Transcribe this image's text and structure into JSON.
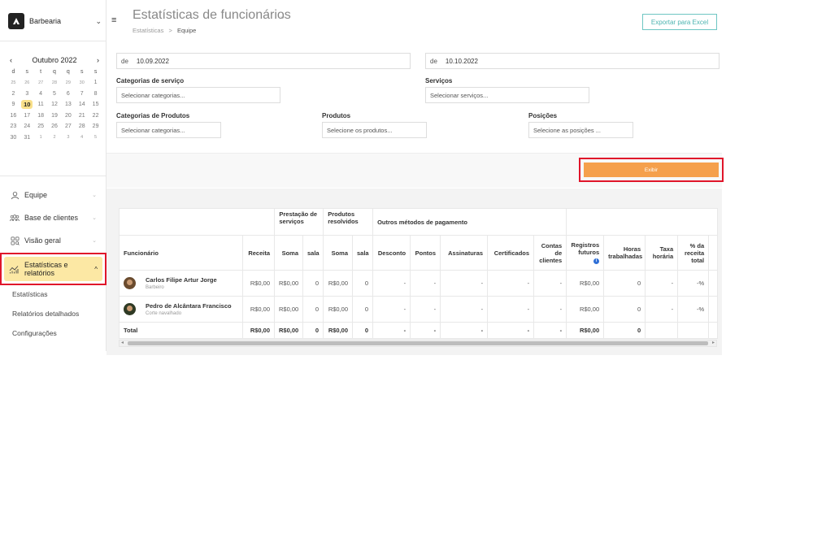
{
  "brand": {
    "name": "Barbearia"
  },
  "calendar": {
    "month_label": "Outubro 2022",
    "weekdays": [
      "d",
      "s",
      "t",
      "q",
      "q",
      "s",
      "s"
    ],
    "weeks": [
      [
        {
          "d": "25",
          "o": true
        },
        {
          "d": "26",
          "o": true
        },
        {
          "d": "27",
          "o": true
        },
        {
          "d": "28",
          "o": true
        },
        {
          "d": "29",
          "o": true
        },
        {
          "d": "30",
          "o": true
        },
        {
          "d": "1",
          "o": false
        }
      ],
      [
        {
          "d": "2",
          "o": false
        },
        {
          "d": "3",
          "o": false
        },
        {
          "d": "4",
          "o": false
        },
        {
          "d": "5",
          "o": false
        },
        {
          "d": "6",
          "o": false
        },
        {
          "d": "7",
          "o": false
        },
        {
          "d": "8",
          "o": false
        }
      ],
      [
        {
          "d": "9",
          "o": false
        },
        {
          "d": "10",
          "o": false,
          "t": true
        },
        {
          "d": "11",
          "o": false
        },
        {
          "d": "12",
          "o": false
        },
        {
          "d": "13",
          "o": false
        },
        {
          "d": "14",
          "o": false
        },
        {
          "d": "15",
          "o": false
        }
      ],
      [
        {
          "d": "16",
          "o": false
        },
        {
          "d": "17",
          "o": false
        },
        {
          "d": "18",
          "o": false
        },
        {
          "d": "19",
          "o": false
        },
        {
          "d": "20",
          "o": false
        },
        {
          "d": "21",
          "o": false
        },
        {
          "d": "22",
          "o": false
        }
      ],
      [
        {
          "d": "23",
          "o": false
        },
        {
          "d": "24",
          "o": false
        },
        {
          "d": "25",
          "o": false
        },
        {
          "d": "26",
          "o": false
        },
        {
          "d": "27",
          "o": false
        },
        {
          "d": "28",
          "o": false
        },
        {
          "d": "29",
          "o": false
        }
      ],
      [
        {
          "d": "30",
          "o": false
        },
        {
          "d": "31",
          "o": false
        },
        {
          "d": "1",
          "o": true
        },
        {
          "d": "2",
          "o": true
        },
        {
          "d": "3",
          "o": true
        },
        {
          "d": "4",
          "o": true
        },
        {
          "d": "5",
          "o": true
        }
      ]
    ]
  },
  "nav": {
    "team": "Equipe",
    "clients": "Base de clientes",
    "overview": "Visão geral",
    "stats": "Estatísticas e relatórios",
    "sub": [
      "Estatísticas",
      "Relatórios detalhados",
      "Configurações"
    ]
  },
  "header": {
    "title": "Estatísticas de funcionários",
    "crumb_parent": "Estatísticas",
    "crumb_sep": ">",
    "crumb_current": "Equipe",
    "export_label": "Exportar para Excel"
  },
  "filters": {
    "from_prefix": "de",
    "from_value": "10.09.2022",
    "to_prefix": "de",
    "to_value": "10.10.2022",
    "service_categories_label": "Categorias de serviço",
    "service_categories_placeholder": "Selecionar categorias...",
    "services_label": "Serviços",
    "services_placeholder": "Selecionar serviços...",
    "product_categories_label": "Categorias de Produtos",
    "product_categories_placeholder": "Selecionar categorias...",
    "products_label": "Produtos",
    "products_placeholder": "Selecione os produtos...",
    "positions_label": "Posições",
    "positions_placeholder": "Selecione as posições ...",
    "show_label": "Exibir"
  },
  "table": {
    "group_services": "Prestação de serviços",
    "group_products": "Produtos resolvidos",
    "group_other": "Outros métodos de pagamento",
    "h_employee": "Funcionário",
    "h_revenue": "Receita",
    "h_sum": "Soma",
    "h_room": "sala",
    "h_discount": "Desconto",
    "h_points": "Pontos",
    "h_subscriptions": "Assinaturas",
    "h_certificates": "Certificados",
    "h_accounts": "Contas de clientes",
    "h_future": "Registros futuros",
    "h_hours": "Horas trabalhadas",
    "h_rate": "Taxa horária",
    "h_share": "% da receita total",
    "info_glyph": "i",
    "rows": [
      {
        "name": "Carlos Filipe Artur Jorge",
        "role": "Barbeiro",
        "revenue": "R$0,00",
        "s_sum": "R$0,00",
        "s_room": "0",
        "p_sum": "R$0,00",
        "p_room": "0",
        "discount": "-",
        "points": "-",
        "subs": "-",
        "certs": "-",
        "accounts": "-",
        "future": "R$0,00",
        "hours": "0",
        "rate": "-",
        "share": "-%"
      },
      {
        "name": "Pedro de Alcântara Francisco",
        "role": "Corte navalhado",
        "revenue": "R$0,00",
        "s_sum": "R$0,00",
        "s_room": "0",
        "p_sum": "R$0,00",
        "p_room": "0",
        "discount": "-",
        "points": "-",
        "subs": "-",
        "certs": "-",
        "accounts": "-",
        "future": "R$0,00",
        "hours": "0",
        "rate": "-",
        "share": "-%"
      }
    ],
    "total": {
      "label": "Total",
      "revenue": "R$0,00",
      "s_sum": "R$0,00",
      "s_room": "0",
      "p_sum": "R$0,00",
      "p_room": "0",
      "discount": "-",
      "points": "-",
      "subs": "-",
      "certs": "-",
      "accounts": "-",
      "future": "R$0,00",
      "hours": "0"
    }
  },
  "colors": {
    "accent": "#f5a04c",
    "highlight": "#fce8a4",
    "export": "#4bb3b0",
    "annotation": "#e0152a"
  }
}
